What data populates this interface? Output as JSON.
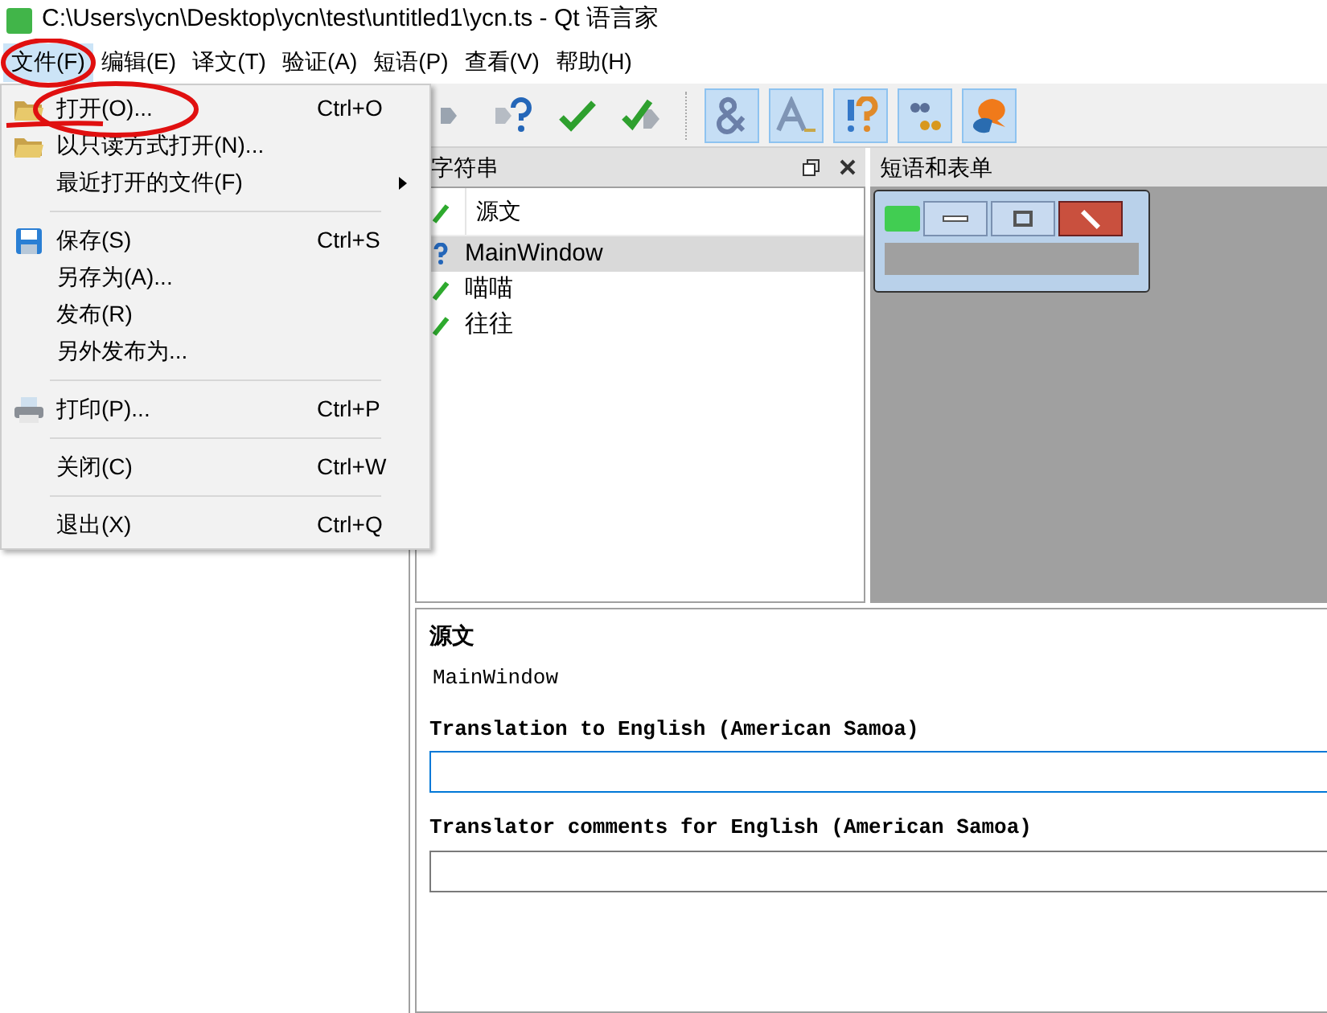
{
  "window": {
    "title": "C:\\Users\\ycn\\Desktop\\ycn\\test\\untitled1\\ycn.ts - Qt 语言家"
  },
  "menubar": [
    {
      "label": "文件(F)",
      "selected": true
    },
    {
      "label": "编辑(E)",
      "selected": false
    },
    {
      "label": "译文(T)",
      "selected": false
    },
    {
      "label": "验证(A)",
      "selected": false
    },
    {
      "label": "短语(P)",
      "selected": false
    },
    {
      "label": "查看(V)",
      "selected": false
    },
    {
      "label": "帮助(H)",
      "selected": false
    }
  ],
  "file_menu": [
    {
      "kind": "open",
      "label": "打开(O)...",
      "shortcut": "Ctrl+O"
    },
    {
      "kind": "open",
      "label": "以只读方式打开(N)..."
    },
    {
      "kind": "submenu",
      "label": "最近打开的文件(F)"
    },
    {
      "kind": "separator"
    },
    {
      "kind": "save",
      "label": "保存(S)",
      "shortcut": "Ctrl+S"
    },
    {
      "kind": "item",
      "label": "另存为(A)..."
    },
    {
      "kind": "item",
      "label": "发布(R)"
    },
    {
      "kind": "item",
      "label": "另外发布为..."
    },
    {
      "kind": "separator"
    },
    {
      "kind": "print",
      "label": "打印(P)...",
      "shortcut": "Ctrl+P"
    },
    {
      "kind": "separator"
    },
    {
      "kind": "item",
      "label": "关闭(C)",
      "shortcut": "Ctrl+W"
    },
    {
      "kind": "separator"
    },
    {
      "kind": "item",
      "label": "退出(X)",
      "shortcut": "Ctrl+Q"
    }
  ],
  "toolbar": [
    {
      "kind": "prev-unfinished"
    },
    {
      "kind": "next-unfinished"
    },
    {
      "kind": "done"
    },
    {
      "kind": "done-next"
    },
    {
      "kind": "separator"
    },
    {
      "kind": "accelerator",
      "checked": true
    },
    {
      "kind": "surrounding-space",
      "checked": true
    },
    {
      "kind": "punctuation",
      "checked": true
    },
    {
      "kind": "phrase-match",
      "checked": true
    },
    {
      "kind": "place-marker",
      "checked": true
    }
  ],
  "strings_panel": {
    "title": "字符串",
    "column": "源文",
    "rows": [
      {
        "text": "MainWindow",
        "kind": "unfinished",
        "selected": true
      },
      {
        "text": "喵喵",
        "kind": "done",
        "selected": false
      },
      {
        "text": "往往",
        "kind": "done",
        "selected": false
      }
    ]
  },
  "phrases_panel": {
    "title": "短语和表单"
  },
  "editor": {
    "source_label": "源文",
    "source_text": "MainWindow",
    "fields": [
      {
        "label": "Translation to English (American Samoa)",
        "focused": true
      },
      {
        "label": "Translator comments for English (American Samoa)",
        "focused": false
      }
    ]
  }
}
